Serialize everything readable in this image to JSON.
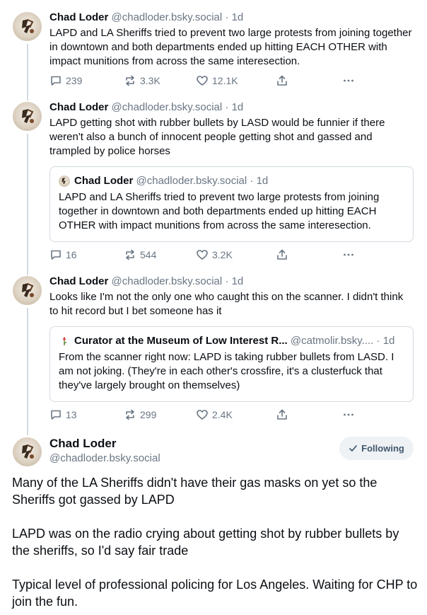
{
  "posts": [
    {
      "name": "Chad Loder",
      "handle": "@chadloder.bsky.social",
      "separator": "·",
      "time": "1d",
      "text": "LAPD and LA Sheriffs tried to prevent two large protests from joining together in downtown and both departments ended up hitting EACH OTHER with impact munitions from across the same interesection.",
      "replies": "239",
      "reposts": "3.3K",
      "likes": "12.1K"
    },
    {
      "name": "Chad Loder",
      "handle": "@chadloder.bsky.social",
      "separator": "·",
      "time": "1d",
      "text": "LAPD getting shot with rubber bullets by LASD would be funnier if there weren't also a bunch of innocent people getting shot and gassed and trampled by police horses",
      "quote": {
        "name": "Chad Loder",
        "handle": "@chadloder.bsky.social",
        "separator": "·",
        "time": "1d",
        "text": "LAPD and LA Sheriffs tried to prevent two large protests from joining together in downtown and both departments ended up hitting EACH OTHER with impact munitions from across the same interesection."
      },
      "replies": "16",
      "reposts": "544",
      "likes": "3.2K"
    },
    {
      "name": "Chad Loder",
      "handle": "@chadloder.bsky.social",
      "separator": "·",
      "time": "1d",
      "text": "Looks like I'm not the only one who caught this on the scanner. I didn't think to hit record but I bet someone has it",
      "quote": {
        "name": "Curator at the Museum of Low Interest R...",
        "handle": "@catmolir.bsky....",
        "separator": "·",
        "time": "1d",
        "text": "From the scanner right now: LAPD is taking rubber bullets from LASD. I am not joking. (They're in each other's crossfire, it's a clusterfuck that they've largely brought on themselves)"
      },
      "replies": "13",
      "reposts": "299",
      "likes": "2.4K"
    }
  ],
  "main_post": {
    "name": "Chad Loder",
    "handle": "@chadloder.bsky.social",
    "follow_label": "Following",
    "paragraphs": [
      "Many of the LA Sheriffs didn't have their gas masks on yet so the Sheriffs got gassed by LAPD",
      "LAPD was on the radio crying about getting shot by  rubber bullets by the sheriffs, so I'd say fair trade",
      "Typical level of professional policing for Los Angeles. Waiting for CHP to join the fun."
    ]
  },
  "icons": {
    "reply": "reply-bubble-icon",
    "repost": "repost-arrows-icon",
    "like": "heart-icon",
    "share": "share-upload-icon",
    "more": "more-dots-icon",
    "follow": "checkmark-icon"
  },
  "colors": {
    "muted": "#6a7683",
    "thread_line": "#d4dbe2",
    "follow_bg": "#eef2f5",
    "follow_text": "#42576c"
  }
}
